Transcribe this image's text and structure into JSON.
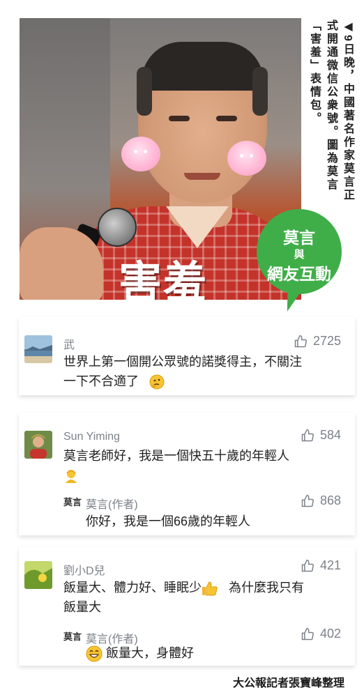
{
  "header": {
    "photo_overlay": "害羞",
    "caption_mark": "◀",
    "caption": "9日晚，中國著名作家莫言正式開通微信公衆號。圖為莫言「害羞」表情包。",
    "badge": {
      "line1": "莫言",
      "line2": "與",
      "line3": "網友互動"
    }
  },
  "comments": [
    {
      "user": "武",
      "likes": "2725",
      "text_line1": "世界上第一個開公眾號的諾獎得主，不關注",
      "text_line2": "一下不合適了",
      "reply": null
    },
    {
      "user": "Sun Yiming",
      "likes": "584",
      "text_line1": "莫言老師好，我是一個快五十歲的年輕人",
      "reply": {
        "user": "莫言(作者)",
        "likes": "868",
        "text": "你好，我是一個66歲的年輕人",
        "avatar_text": "莫言"
      }
    },
    {
      "user": "劉小D兒",
      "likes": "421",
      "text_line1_a": "飯量大、體力好、睡眠少",
      "text_line1_b": "為什麼我只有",
      "text_line2": "飯量大",
      "reply": {
        "user": "莫言(作者)",
        "likes": "402",
        "text": "飯量大，身體好",
        "avatar_text": "莫言"
      }
    }
  ],
  "credit": "大公報記者張寶峰整理",
  "colors": {
    "badge_green": "#3fae48",
    "meta_gray": "#7c8189",
    "blush_pink": "#ffb8d6"
  },
  "icons": [
    "thumbs-up-icon",
    "thinking-emoji",
    "person-emoji",
    "thumbs-up-emoji",
    "grin-emoji"
  ]
}
